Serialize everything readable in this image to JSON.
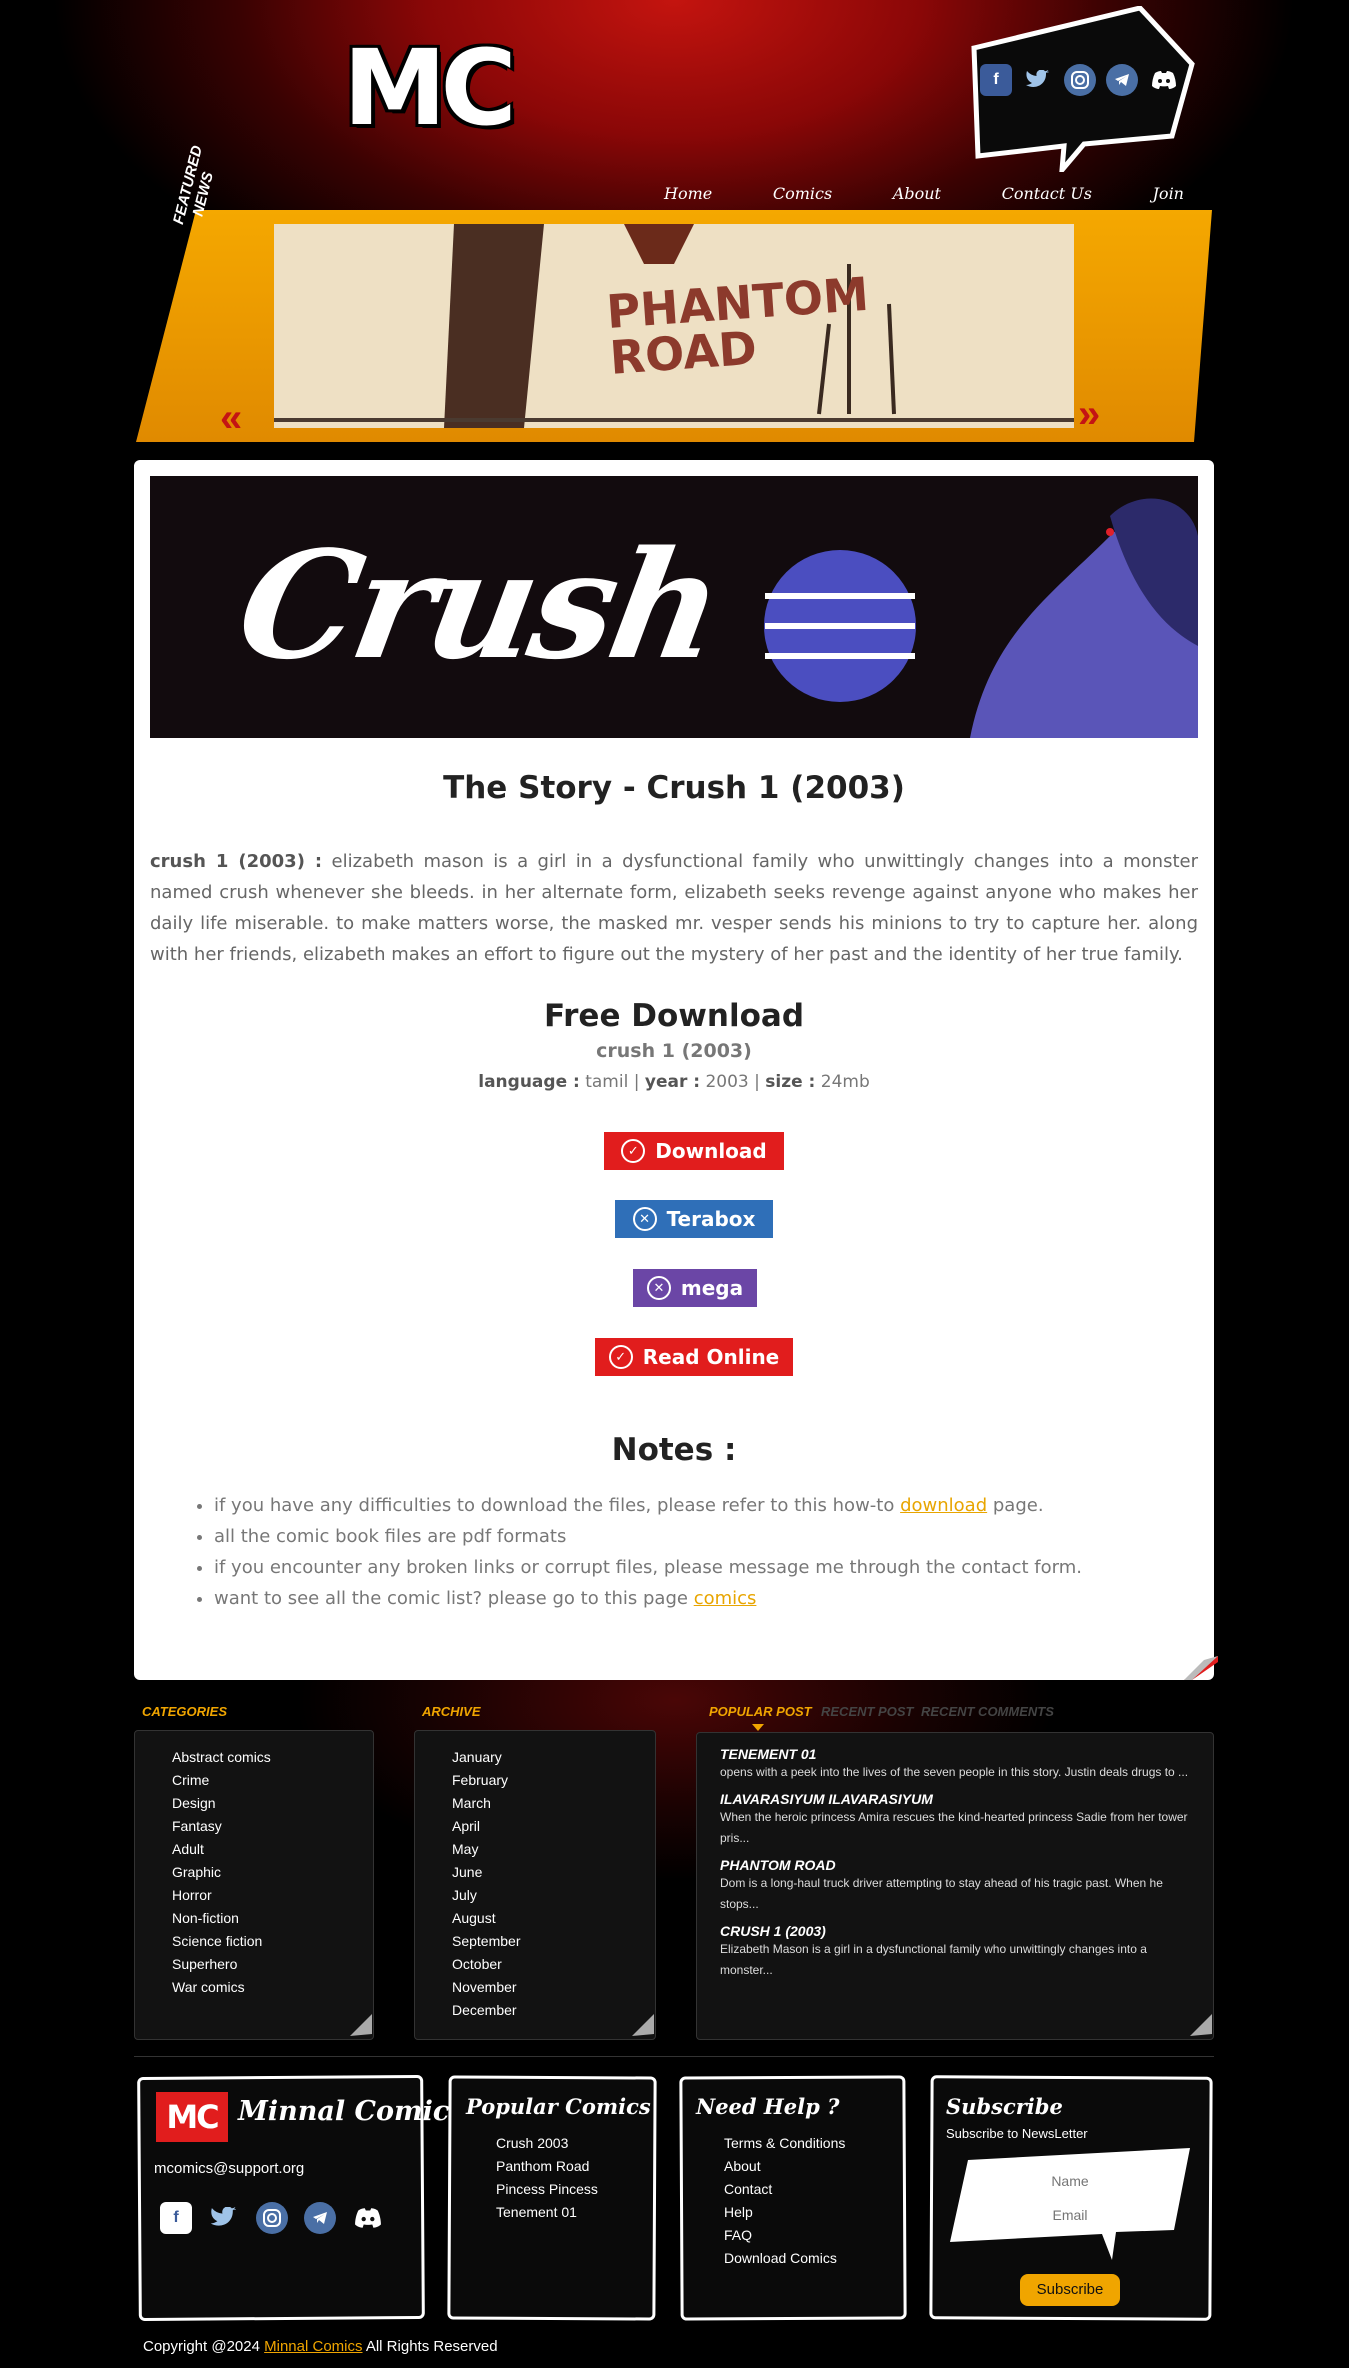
{
  "logo": "MC",
  "nav": [
    "Home",
    "Comics",
    "About",
    "Contact Us",
    "Join"
  ],
  "featured": {
    "label": "FEATURED NEWS",
    "image_text": "PHANTOM ROAD"
  },
  "hero": {
    "title": "Crush"
  },
  "story": {
    "heading": "The Story - Crush 1 (2003)",
    "lead": "crush 1 (2003) :",
    "text": "elizabeth mason is a girl in a dysfunctional family who unwittingly changes into a monster named crush whenever she bleeds. in her alternate form, elizabeth seeks revenge against anyone who makes her daily life miserable. to make matters worse, the masked mr. vesper sends his minions to try to capture her. along with her friends, elizabeth makes an effort to figure out the mystery of her past and the identity of her true family."
  },
  "download": {
    "heading": "Free Download",
    "subtitle": "crush 1 (2003)",
    "language_label": "language :",
    "language": "tamil",
    "year_label": "year :",
    "year": "2003",
    "size_label": "size :",
    "size": "24mb",
    "buttons": [
      {
        "label": "Download",
        "color": "#e11d1d"
      },
      {
        "label": "Terabox",
        "color": "#2f6fb8"
      },
      {
        "label": "mega",
        "color": "#6b46a6"
      },
      {
        "label": "Read Online",
        "color": "#e11d1d"
      }
    ]
  },
  "notes": {
    "heading": "Notes :",
    "n1_pre": "if you have any difficulties to download the files, please refer to this how-to",
    "n1_link": "download",
    "n1_post": "page.",
    "n2": "all the comic book files are pdf formats",
    "n3": "if you encounter any broken links or corrupt files, please message me through the contact form.",
    "n4_pre": "want to see all the comic list? please go to this page",
    "n4_link": "comics"
  },
  "categories": {
    "heading": "CATEGORIES",
    "items": [
      "Abstract comics",
      "Crime",
      "Design",
      "Fantasy",
      "Adult",
      "Graphic",
      "Horror",
      "Non-fiction",
      "Science fiction",
      "Superhero",
      "War comics"
    ]
  },
  "archive": {
    "heading": "ARCHIVE",
    "items": [
      "January",
      "February",
      "March",
      "April",
      "May",
      "June",
      "July",
      "August",
      "September",
      "October",
      "November",
      "December"
    ]
  },
  "posts": {
    "tabs": [
      "POPULAR POST",
      "RECENT POST",
      "RECENT COMMENTS"
    ],
    "items": [
      {
        "title": "TENEMENT 01",
        "text": "opens with a peek into the lives of the seven people in this story. Justin deals drugs to ..."
      },
      {
        "title": "ILAVARASIYUM ILAVARASIYUM",
        "text": "When the heroic princess Amira rescues the kind-hearted princess Sadie from her tower pris..."
      },
      {
        "title": "PHANTOM ROAD",
        "text": "Dom is a long-haul truck driver attempting to stay ahead of his tragic past. When he stops..."
      },
      {
        "title": "CRUSH 1 (2003)",
        "text": "Elizabeth Mason is a girl in a dysfunctional family who unwittingly changes into a monster..."
      }
    ]
  },
  "footer": {
    "brand_logo": "MC",
    "brand_name": "Minnal ComicS",
    "email": "mcomics@support.org",
    "popular_heading": "Popular Comics",
    "popular": [
      "Crush 2003",
      "Panthom Road",
      "Pincess Pincess",
      "Tenement 01"
    ],
    "help_heading": "Need Help ?",
    "help": [
      "Terms & Conditions",
      "About",
      "Contact",
      "Help",
      "FAQ",
      "Download Comics"
    ],
    "subscribe_heading": "Subscribe",
    "subscribe_sub": "Subscribe to NewsLetter",
    "name_placeholder": "Name",
    "email_placeholder": "Email",
    "subscribe_button": "Subscribe",
    "copyright_pre": "Copyright @2024",
    "copyright_link": "Minnal Comics",
    "copyright_post": "All Rights Reserved"
  },
  "social_icons": [
    "facebook-icon",
    "twitter-icon",
    "instagram-icon",
    "telegram-icon",
    "discord-icon"
  ],
  "colors": {
    "accent": "#f0a500",
    "brand_red": "#e11d1d"
  }
}
